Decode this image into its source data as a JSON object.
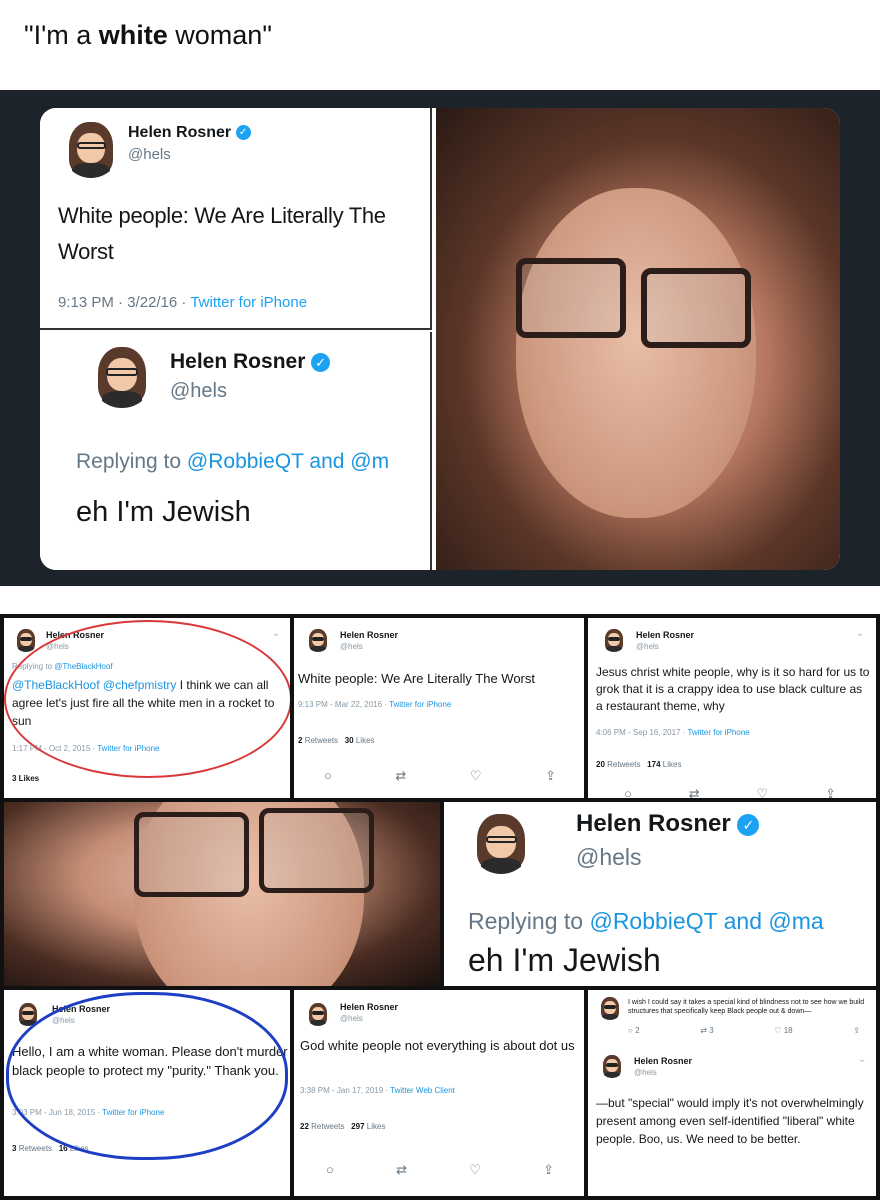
{
  "caption": {
    "prefix": "\"I'm a ",
    "bold": "white",
    "suffix": " woman\""
  },
  "meme_top": {
    "tweet1": {
      "name": "Helen Rosner",
      "handle": "@hels",
      "text": "White people: We Are Literally The Worst",
      "time": "9:13 PM · 3/22/16 ·",
      "client": "Twitter for iPhone"
    },
    "tweet2": {
      "name": "Helen Rosner",
      "handle": "@hels",
      "reply_prefix": "Replying to",
      "reply_to": "@RobbieQT and @m",
      "text": "eh I'm Jewish"
    }
  },
  "collage": {
    "tile1": {
      "name": "Helen Rosner",
      "handle": "@hels",
      "reply_prefix": "Replying to",
      "reply_to": "@TheBlackHoof",
      "mentions": "@TheBlackHoof @chefpmistry",
      "text": " I think we can all agree let's just fire all the white men in a rocket to sun",
      "time": "1:17 PM - Oct 2, 2015 ·",
      "client": "Twitter for iPhone",
      "likes": "3 Likes"
    },
    "tile2": {
      "name": "Helen Rosner",
      "handle": "@hels",
      "text": "White people: We Are Literally The Worst",
      "time": "9:13 PM - Mar 22, 2016 ·",
      "client": "Twitter for iPhone",
      "retweets_num": "2",
      "retweets_label": "Retweets",
      "likes_num": "30",
      "likes_label": "Likes"
    },
    "tile3": {
      "name": "Helen Rosner",
      "handle": "@hels",
      "text": "Jesus christ white people, why is it so hard for us to grok that it is a crappy idea to use black culture as a restaurant theme, why",
      "time": "4:06 PM - Sep 16, 2017 ·",
      "client": "Twitter for iPhone",
      "retweets_num": "20",
      "retweets_label": "Retweets",
      "likes_num": "174",
      "likes_label": "Likes"
    },
    "tile5": {
      "name": "Helen Rosner",
      "handle": "@hels",
      "reply_prefix": "Replying to",
      "reply_to": "@RobbieQT and @ma",
      "text": "eh I'm Jewish"
    },
    "tile6": {
      "name": "Helen Rosner",
      "handle": "@hels",
      "text": "Hello, I am a white woman. Please don't murder black people to protect my \"purity.\" Thank you.",
      "time": "3:03 PM - Jun 18, 2015 ·",
      "client": "Twitter for iPhone",
      "retweets_num": "3",
      "retweets_label": "Retweets",
      "likes_num": "16",
      "likes_label": "Likes"
    },
    "tile7": {
      "name": "Helen Rosner",
      "handle": "@hels",
      "text": "God white people not everything is about dot us",
      "time": "3:38 PM - Jan 17, 2019 ·",
      "client": "Twitter Web Client",
      "retweets_num": "22",
      "retweets_label": "Retweets",
      "likes_num": "297",
      "likes_label": "Likes"
    },
    "tile8": {
      "top_text": "I wish I could say it takes a special kind of blindness not to see how we build structures that specifically keep Black people out & down—",
      "top_replies": "2",
      "top_retweets": "3",
      "top_likes": "18",
      "name": "Helen Rosner",
      "handle": "@hels",
      "text": "—but \"special\" would imply it's not overwhelmingly present among even self-identified \"liberal\" white people. Boo, us. We need to be better."
    },
    "icons": {
      "reply": "reply-icon",
      "retweet": "retweet-icon",
      "like": "heart-icon",
      "share": "share-icon"
    }
  },
  "colors": {
    "twitter_blue": "#1da1f2",
    "red_circle": "#d9383a",
    "blue_circle": "#1e3fc4"
  }
}
